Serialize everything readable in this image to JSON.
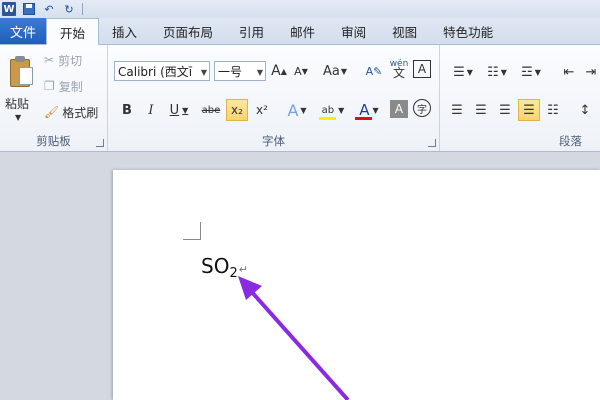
{
  "qat": {
    "logo_letter": "W",
    "undo_glyph": "↶",
    "redo_glyph": "↻"
  },
  "tabs": {
    "file": "文件",
    "items": [
      "开始",
      "插入",
      "页面布局",
      "引用",
      "邮件",
      "审阅",
      "视图",
      "特色功能"
    ]
  },
  "clipboard": {
    "paste_label": "粘贴",
    "cut_label": "剪切",
    "copy_label": "复制",
    "format_painter_label": "格式刷",
    "group_label": "剪贴板"
  },
  "font": {
    "font_name": "Calibri (西文ī",
    "font_size": "一号",
    "grow_label": "A",
    "shrink_label": "A",
    "case_label": "Aa",
    "bold_label": "B",
    "italic_label": "I",
    "underline_label": "U",
    "strike_label": "abe",
    "subscript_label": "x₂",
    "superscript_label": "x²",
    "effects_label": "A",
    "highlight_label": "ab",
    "color_label": "A",
    "shade_label": "A",
    "enclose_label": "字",
    "phonetic_label": "wén",
    "border_label": "A",
    "group_label": "字体"
  },
  "paragraph": {
    "group_label": "段落"
  },
  "colors": {
    "file_tab": "#1f5fb9",
    "highlight": "#ffee00",
    "font_color": "#d4141b",
    "active_button": "#f8d472",
    "arrow": "#8a2be2"
  },
  "document": {
    "text_main": "SO",
    "text_sub": "2",
    "para_mark": "↵"
  }
}
